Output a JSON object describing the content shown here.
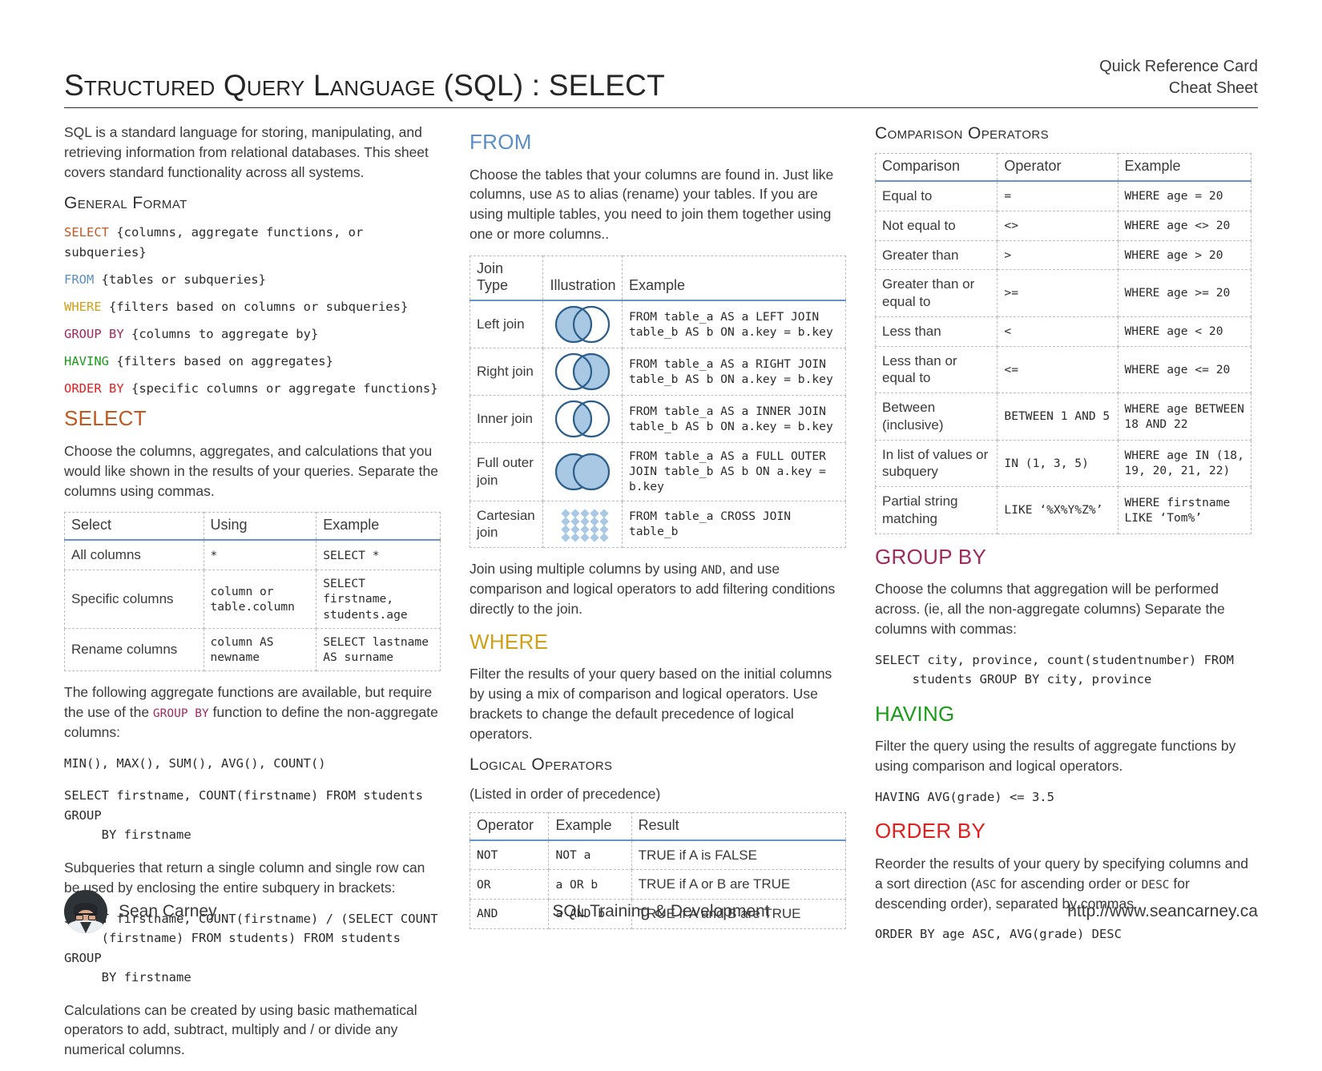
{
  "header": {
    "title": "Structured Query Language (SQL) : SELECT",
    "right_line1": "Quick Reference Card",
    "right_line2": "Cheat Sheet"
  },
  "colors": {
    "select": "#c0581f",
    "from": "#5b8ec4",
    "where": "#cfa018",
    "group_by": "#9e2a5e",
    "having": "#1a9c1a",
    "order_by": "#e02020",
    "table_header_rule": "#6494c8",
    "venn_fill": "#a8c8e4",
    "venn_stroke": "#2e5f8a"
  },
  "left": {
    "intro": "SQL is a standard language for storing, manipulating, and retrieving information from relational databases. This sheet covers standard functionality across all systems.",
    "general_format": {
      "heading": "General Format",
      "lines": [
        {
          "keyword": "SELECT",
          "rest": " {columns, aggregate functions, or subqueries}",
          "color_class": "kw-select"
        },
        {
          "keyword": "FROM",
          "rest": " {tables or subqueries}",
          "color_class": "kw-from"
        },
        {
          "keyword": "WHERE",
          "rest": " {filters based on columns or subqueries}",
          "color_class": "kw-where"
        },
        {
          "keyword": "GROUP BY",
          "rest": " {columns to aggregate by}",
          "color_class": "kw-groupby"
        },
        {
          "keyword": "HAVING",
          "rest": " {filters based on aggregates}",
          "color_class": "kw-having"
        },
        {
          "keyword": "ORDER BY",
          "rest": " {specific columns or aggregate functions}",
          "color_class": "kw-orderby"
        }
      ]
    },
    "select": {
      "heading": "SELECT",
      "paragraph": "Choose the columns, aggregates, and calculations that you would like shown in the results of your queries. Separate the columns using commas.",
      "table": {
        "headers": [
          "Select",
          "Using",
          "Example"
        ],
        "rows": [
          {
            "select": "All columns",
            "using": "*",
            "example": "SELECT *"
          },
          {
            "select": "Specific columns",
            "using": "column or\ntable.column",
            "example": "SELECT firstname,\nstudents.age"
          },
          {
            "select": "Rename columns",
            "using": "column AS\nnewname",
            "example": "SELECT lastname\nAS surname"
          }
        ]
      },
      "aggregate_note_a": "The following aggregate functions are available, but require the use of the ",
      "aggregate_note_kw": "GROUP BY",
      "aggregate_note_b": " function to define the non-aggregate columns:",
      "aggregate_functions": "MIN(), MAX(), SUM(), AVG(), COUNT()",
      "aggregate_example": "SELECT firstname, COUNT(firstname) FROM students GROUP\n     BY firstname",
      "subquery_note": "Subqueries that return a single column and single row can be used by enclosing the entire subquery in brackets:",
      "subquery_example": "SELECT firstname, COUNT(firstname) / (SELECT COUNT\n     (firstname) FROM students) FROM students GROUP\n     BY firstname",
      "calculations_note": "Calculations can be created by using basic mathematical operators to add, subtract, multiply and / or divide any numerical columns."
    }
  },
  "middle": {
    "from": {
      "heading": "FROM",
      "paragraph_a": "Choose the tables that your columns are found in. Just like columns, use ",
      "paragraph_kw": "AS",
      "paragraph_b": " to alias (rename) your tables. If you are using multiple tables, you need to join them together using one or more columns..",
      "table": {
        "headers": [
          "Join Type",
          "Illustration",
          "Example"
        ],
        "rows": [
          {
            "type": "Left join",
            "venn": "left-join-venn",
            "example": "FROM table_a AS a LEFT JOIN\ntable_b AS b ON a.key = b.key"
          },
          {
            "type": "Right join",
            "venn": "right-join-venn",
            "example": "FROM table_a AS a RIGHT JOIN\ntable_b AS b ON a.key = b.key"
          },
          {
            "type": "Inner join",
            "venn": "inner-join-venn",
            "example": "FROM table_a AS a INNER JOIN\ntable_b AS b ON a.key = b.key"
          },
          {
            "type": "Full outer join",
            "venn": "full-outer-join-venn",
            "example": "FROM table_a AS a FULL OUTER\nJOIN table_b AS b ON a.key =\nb.key"
          },
          {
            "type": "Cartesian join",
            "venn": "cartesian-join-grid",
            "example": "FROM table_a CROSS JOIN\ntable_b"
          }
        ]
      },
      "join_note_a": "Join using multiple columns by using ",
      "join_note_kw": "AND",
      "join_note_b": ", and use comparison and logical operators to add filtering conditions directly to the join."
    },
    "where": {
      "heading": "WHERE",
      "paragraph": "Filter the results of your query based on the initial columns by using a mix of comparison and logical operators. Use brackets to change the default precedence of logical operators.",
      "logical_heading": "Logical Operators",
      "logical_note": "(Listed in order of precedence)",
      "table": {
        "headers": [
          "Operator",
          "Example",
          "Result"
        ],
        "rows": [
          {
            "operator": "NOT",
            "example": "NOT a",
            "result": "TRUE if A is FALSE"
          },
          {
            "operator": "OR",
            "example": "a OR b",
            "result": "TRUE if A or B are TRUE"
          },
          {
            "operator": "AND",
            "example": "a AND b",
            "result": "TRUE if A and B are TRUE"
          }
        ]
      }
    }
  },
  "right": {
    "comparison": {
      "heading": "Comparison Operators",
      "table": {
        "headers": [
          "Comparison",
          "Operator",
          "Example"
        ],
        "rows": [
          {
            "comparison": "Equal to",
            "operator": "=",
            "example": "WHERE age = 20"
          },
          {
            "comparison": "Not equal to",
            "operator": "<>",
            "example": "WHERE age <> 20"
          },
          {
            "comparison": "Greater than",
            "operator": ">",
            "example": "WHERE age > 20"
          },
          {
            "comparison": "Greater than or equal to",
            "operator": ">=",
            "example": "WHERE age >= 20"
          },
          {
            "comparison": "Less than",
            "operator": "<",
            "example": "WHERE age < 20"
          },
          {
            "comparison": "Less than or equal to",
            "operator": "<=",
            "example": "WHERE age <= 20"
          },
          {
            "comparison": "Between (inclusive)",
            "operator": "BETWEEN 1 AND 5",
            "example": "WHERE age\nBETWEEN 18 AND\n22"
          },
          {
            "comparison": "In list of values or subquery",
            "operator": "IN (1, 3, 5)",
            "example": "WHERE age IN\n(18, 19, 20, 21,\n22)"
          },
          {
            "comparison": "Partial string matching",
            "operator": "LIKE ‘%X%Y%Z%’",
            "example": "WHERE firstname\nLIKE ‘Tom%’"
          }
        ]
      }
    },
    "group_by": {
      "heading": "GROUP BY",
      "paragraph": "Choose the columns that aggregation will be performed across. (ie, all the non-aggregate columns)  Separate the columns with  commas:",
      "example": "SELECT city, province, count(studentnumber) FROM\n     students GROUP BY city, province"
    },
    "having": {
      "heading": "HAVING",
      "paragraph": "Filter the query using the results of aggregate functions by using comparison and logical operators.",
      "example": "HAVING AVG(grade) <= 3.5"
    },
    "order_by": {
      "heading": "ORDER BY",
      "paragraph_a": "Reorder the results of your query by specifying columns and a sort direction (",
      "paragraph_kw1": "ASC",
      "paragraph_mid": " for ascending order or ",
      "paragraph_kw2": "DESC",
      "paragraph_b": " for descending order), separated by commas.",
      "example": "ORDER BY age ASC, AVG(grade) DESC"
    }
  },
  "footer": {
    "author": "Sean Carney",
    "center": "SQL Training & Development",
    "url": "http://www.seancarney.ca"
  }
}
